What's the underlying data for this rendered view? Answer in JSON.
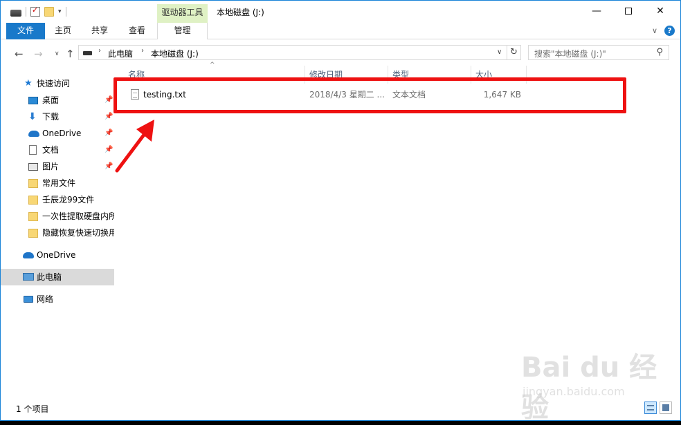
{
  "titlebar": {
    "context_tab": "驱动器工具",
    "title": "本地磁盘 (J:)",
    "minimize": "—",
    "close": "✕"
  },
  "ribbon": {
    "tabs": [
      "文件",
      "主页",
      "共享",
      "查看",
      "管理"
    ]
  },
  "address": {
    "crumbs": [
      "此电脑",
      "本地磁盘 (J:)"
    ],
    "search_placeholder": "搜索\"本地磁盘 (J:)\""
  },
  "sidebar": {
    "items": [
      {
        "label": "快速访问",
        "icon": "star-icon"
      },
      {
        "label": "桌面",
        "icon": "desktop-icon",
        "pinned": true
      },
      {
        "label": "下载",
        "icon": "download-icon",
        "pinned": true
      },
      {
        "label": "OneDrive",
        "icon": "cloud-icon",
        "pinned": true
      },
      {
        "label": "文档",
        "icon": "document-icon",
        "pinned": true
      },
      {
        "label": "图片",
        "icon": "pictures-icon",
        "pinned": true
      },
      {
        "label": "常用文件",
        "icon": "folder-icon"
      },
      {
        "label": "壬辰龙99文件",
        "icon": "folder-icon"
      },
      {
        "label": "一次性提取硬盘内所",
        "icon": "folder-icon"
      },
      {
        "label": "隐藏恢复快速切换用",
        "icon": "folder-icon"
      },
      {
        "label": "OneDrive",
        "icon": "cloud-icon"
      },
      {
        "label": "此电脑",
        "icon": "computer-icon",
        "selected": true
      },
      {
        "label": "网络",
        "icon": "network-icon"
      }
    ]
  },
  "columns": {
    "name": "名称",
    "date": "修改日期",
    "type": "类型",
    "size": "大小"
  },
  "files": [
    {
      "name": "testing.txt",
      "date": "2018/4/3 星期二 ...",
      "type": "文本文档",
      "size": "1,647 KB"
    }
  ],
  "status": {
    "count": "1 个项目"
  },
  "watermark": {
    "logo": "Bai du 经验",
    "url": "jingyan.baidu.com"
  },
  "colors": {
    "accent": "#1979ca",
    "context_tab": "#dff1c4",
    "highlight": "#ee1111",
    "selected": "#dadada"
  }
}
